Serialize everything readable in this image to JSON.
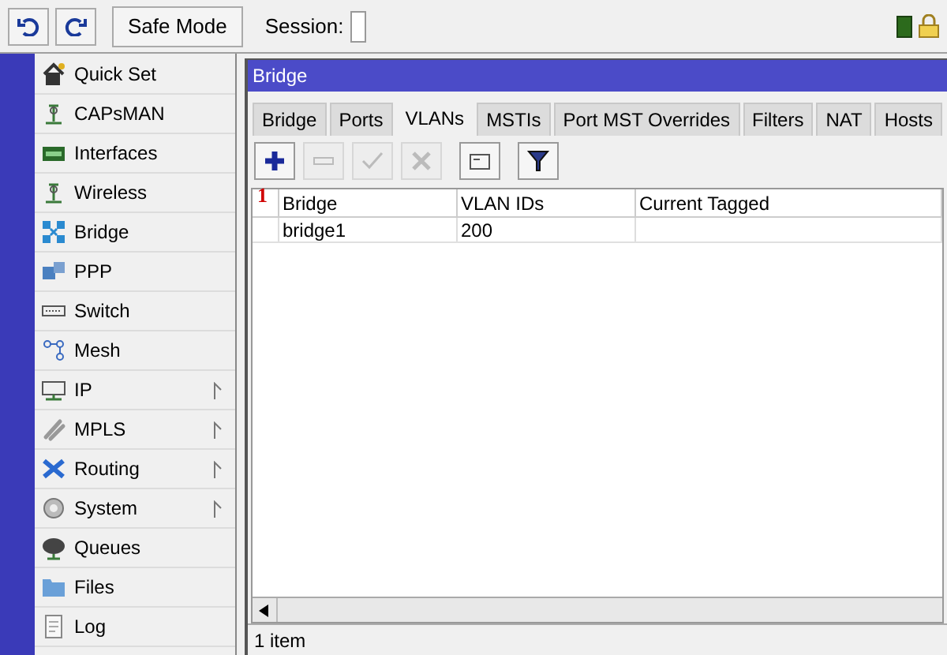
{
  "toolbar": {
    "safe_mode": "Safe Mode",
    "session_label": "Session:"
  },
  "sidebar": {
    "items": [
      {
        "label": "Quick Set",
        "kind": "quickset",
        "submenu": false
      },
      {
        "label": "CAPsMAN",
        "kind": "antenna",
        "submenu": false
      },
      {
        "label": "Interfaces",
        "kind": "interfaces",
        "submenu": false
      },
      {
        "label": "Wireless",
        "kind": "antenna",
        "submenu": false
      },
      {
        "label": "Bridge",
        "kind": "bridge",
        "submenu": false
      },
      {
        "label": "PPP",
        "kind": "ppp",
        "submenu": false
      },
      {
        "label": "Switch",
        "kind": "switch",
        "submenu": false
      },
      {
        "label": "Mesh",
        "kind": "mesh",
        "submenu": false
      },
      {
        "label": "IP",
        "kind": "ip",
        "submenu": true
      },
      {
        "label": "MPLS",
        "kind": "mpls",
        "submenu": true
      },
      {
        "label": "Routing",
        "kind": "routing",
        "submenu": true
      },
      {
        "label": "System",
        "kind": "system",
        "submenu": true
      },
      {
        "label": "Queues",
        "kind": "queues",
        "submenu": false
      },
      {
        "label": "Files",
        "kind": "files",
        "submenu": false
      },
      {
        "label": "Log",
        "kind": "log",
        "submenu": false
      }
    ]
  },
  "window": {
    "title": "Bridge",
    "tabs": [
      {
        "label": "Bridge",
        "selected": false
      },
      {
        "label": "Ports",
        "selected": false
      },
      {
        "label": "VLANs",
        "selected": true
      },
      {
        "label": "MSTIs",
        "selected": false
      },
      {
        "label": "Port MST Overrides",
        "selected": false
      },
      {
        "label": "Filters",
        "selected": false
      },
      {
        "label": "NAT",
        "selected": false
      },
      {
        "label": "Hosts",
        "selected": false
      }
    ],
    "buttons": [
      {
        "kind": "add",
        "disabled": false
      },
      {
        "kind": "remove",
        "disabled": true
      },
      {
        "kind": "enable",
        "disabled": true
      },
      {
        "kind": "disable",
        "disabled": true
      },
      {
        "kind": "comment",
        "disabled": false
      },
      {
        "kind": "filter",
        "disabled": false
      }
    ],
    "annotation": "1",
    "table": {
      "columns": [
        "Bridge",
        "VLAN IDs",
        "Current Tagged"
      ],
      "rows": [
        {
          "cells": [
            "bridge1",
            "200",
            ""
          ],
          "selected": false
        }
      ]
    },
    "status": "1 item"
  }
}
